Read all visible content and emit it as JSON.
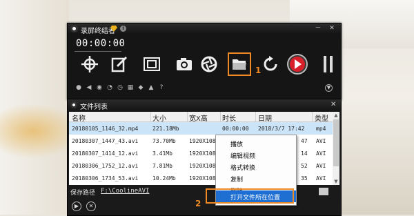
{
  "recorder": {
    "title": "录屏终结者",
    "timer": "00:00:00",
    "window_controls": {
      "minimize": "－",
      "close": "✕"
    },
    "step1": "1",
    "tools": [
      "crosshair-icon",
      "edit-icon",
      "fullscreen-icon",
      "camera-icon",
      "aperture-icon",
      "folder-icon",
      "refresh-icon"
    ],
    "option_icons": [
      "mic-icon",
      "speaker-icon",
      "webcam-icon",
      "clock-icon",
      "timer-icon",
      "calendar-icon",
      "mouse-icon",
      "shirt-icon",
      "help-icon"
    ]
  },
  "filelist": {
    "title": "文件列表",
    "columns": [
      "名称",
      "大小",
      "宽X高",
      "时长",
      "日期",
      "类型"
    ],
    "rows": [
      {
        "name": "20180105_1146_32.mp4",
        "size": "221.18Mb",
        "res": "",
        "duration": "00:00:00",
        "date": "2018/3/7 17:42",
        "type": "mp4"
      },
      {
        "name": "20180307_1447_43.avi",
        "size": "73.70Mb",
        "res": "1920X108",
        "duration": "",
        "date": "47",
        "type": "AVI"
      },
      {
        "name": "20180307_1414_12.avi",
        "size": "3.41Mb",
        "res": "1920X108",
        "duration": "",
        "date": "14",
        "type": "AVI"
      },
      {
        "name": "20180306_1752_12.avi",
        "size": "7.81Mb",
        "res": "1920X108",
        "duration": "",
        "date": "52",
        "type": "AVI"
      },
      {
        "name": "20180306_1734_53.avi",
        "size": "10.24Mb",
        "res": "1920X108",
        "duration": "",
        "date": "35",
        "type": "AVI"
      }
    ],
    "save_label": "保存路径",
    "save_path": "F:\\CoolineAVI",
    "step2": "2"
  },
  "context_menu": {
    "items": [
      "播放",
      "编辑视频",
      "格式转换",
      "复制",
      "删除",
      "打开文件所在位置"
    ]
  },
  "colors": {
    "accent": "#f08a24",
    "highlight": "#1e6fd1",
    "record": "#d8202a"
  }
}
